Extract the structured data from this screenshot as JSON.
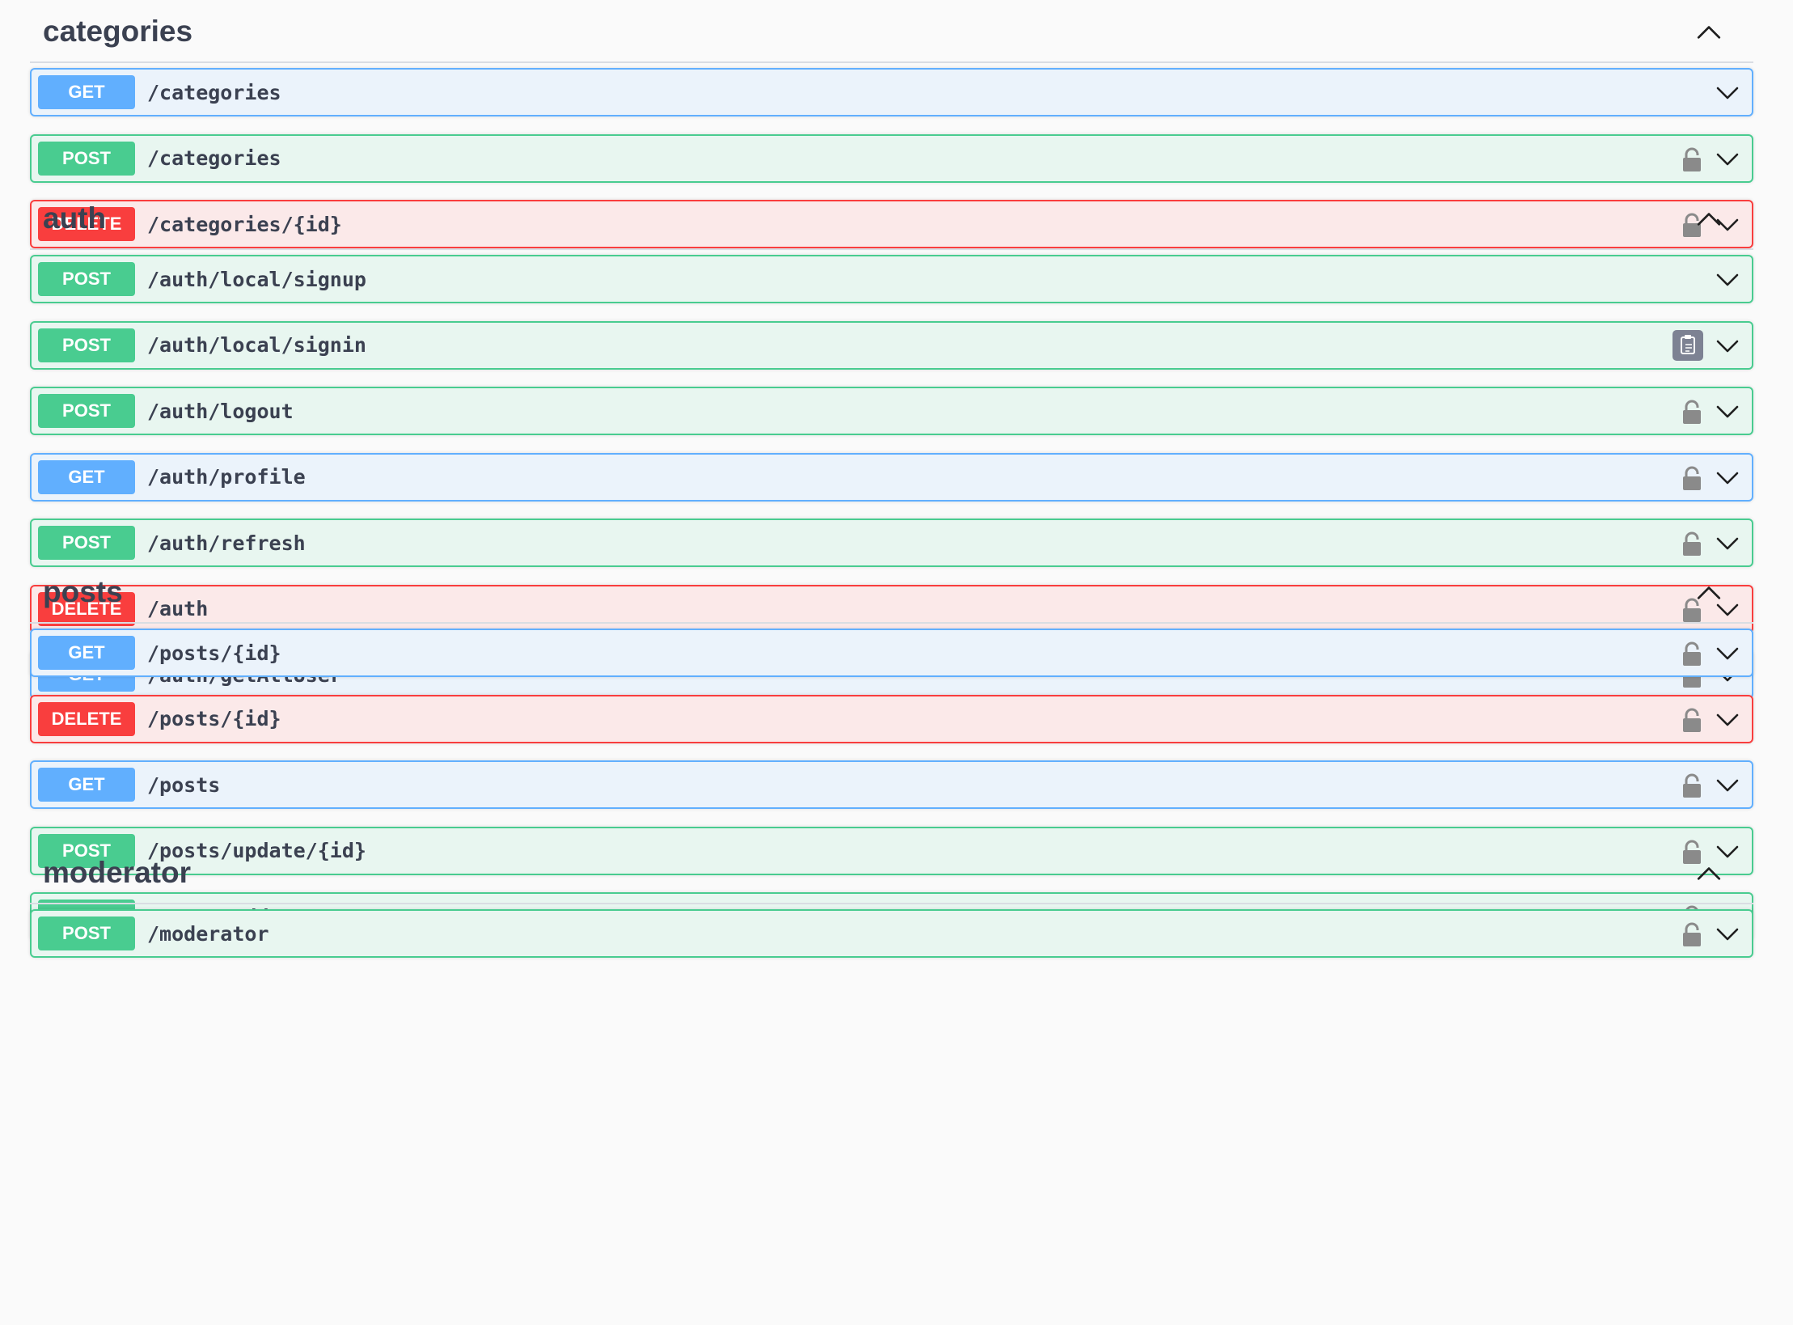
{
  "sections": [
    {
      "title": "categories",
      "operations": [
        {
          "method": "GET",
          "path": "/categories",
          "icon": "none"
        },
        {
          "method": "POST",
          "path": "/categories",
          "icon": "lock-icon"
        },
        {
          "method": "DELETE",
          "path": "/categories/{id}",
          "icon": "lock-icon"
        }
      ]
    },
    {
      "title": "auth",
      "operations": [
        {
          "method": "POST",
          "path": "/auth/local/signup",
          "icon": "none"
        },
        {
          "method": "POST",
          "path": "/auth/local/signin",
          "icon": "copy-icon"
        },
        {
          "method": "POST",
          "path": "/auth/logout",
          "icon": "lock-icon"
        },
        {
          "method": "GET",
          "path": "/auth/profile",
          "icon": "lock-icon"
        },
        {
          "method": "POST",
          "path": "/auth/refresh",
          "icon": "lock-icon"
        },
        {
          "method": "DELETE",
          "path": "/auth",
          "icon": "lock-icon"
        },
        {
          "method": "GET",
          "path": "/auth/getAllUser",
          "icon": "lock-icon"
        }
      ]
    },
    {
      "title": "posts",
      "operations": [
        {
          "method": "GET",
          "path": "/posts/{id}",
          "icon": "lock-icon"
        },
        {
          "method": "DELETE",
          "path": "/posts/{id}",
          "icon": "lock-icon"
        },
        {
          "method": "GET",
          "path": "/posts",
          "icon": "lock-icon"
        },
        {
          "method": "POST",
          "path": "/posts/update/{id}",
          "icon": "lock-icon"
        },
        {
          "method": "POST",
          "path": "/posts/addPost",
          "icon": "lock-icon"
        }
      ]
    },
    {
      "title": "moderator",
      "operations": [
        {
          "method": "POST",
          "path": "/moderator",
          "icon": "lock-icon"
        }
      ]
    }
  ],
  "colors": {
    "get": "#61affe",
    "post": "#49cc90",
    "delete": "#f93e3e",
    "text": "#3b4151"
  }
}
